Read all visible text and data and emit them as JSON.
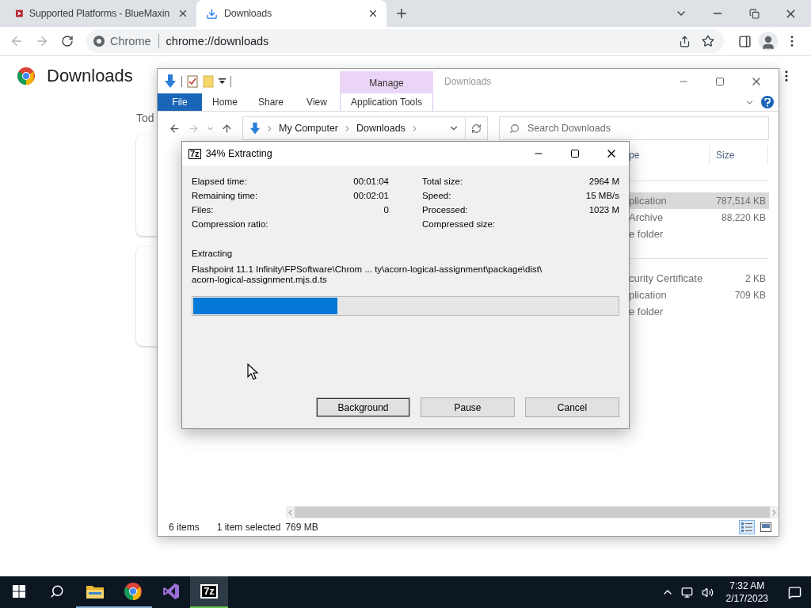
{
  "browser": {
    "tabs": [
      {
        "title": "Supported Platforms - BlueMaxin",
        "kind": "site",
        "selected": false
      },
      {
        "title": "Downloads",
        "kind": "download",
        "selected": true
      }
    ],
    "omnibox": {
      "site_label": "Chrome",
      "url": "chrome://downloads"
    },
    "page": {
      "title": "Downloads",
      "section_heading": "Tod"
    }
  },
  "explorer": {
    "context_group": "Manage",
    "title": "Downloads",
    "ribbon_tabs": [
      {
        "label": "File",
        "kind": "file"
      },
      {
        "label": "Home",
        "kind": "tab"
      },
      {
        "label": "Share",
        "kind": "tab"
      },
      {
        "label": "View",
        "kind": "tab"
      },
      {
        "label": "Application Tools",
        "kind": "context"
      }
    ],
    "breadcrumbs": [
      "My Computer",
      "Downloads"
    ],
    "search": {
      "placeholder": "Search Downloads"
    },
    "columns": [
      "pe",
      "Size"
    ],
    "groups": [
      {
        "rows": [
          {
            "type": "plication",
            "size": "787,514 KB",
            "selected": true
          },
          {
            "type": "Archive",
            "size": "88,220 KB",
            "selected": false
          },
          {
            "type": "e folder",
            "selected": false
          }
        ]
      },
      {
        "rows": [
          {
            "type": "curity Certificate",
            "size": "2 KB",
            "selected": false
          },
          {
            "type": "plication",
            "size": "709 KB",
            "selected": false
          },
          {
            "type": "e folder",
            "selected": false
          }
        ]
      }
    ],
    "status": {
      "item_count": "6 items",
      "selection": "1 item selected",
      "selection_size": "769 MB"
    }
  },
  "dialog": {
    "icon_label": "7z",
    "title": "34% Extracting",
    "stats_left": [
      {
        "label": "Elapsed time:",
        "value": "00:01:04"
      },
      {
        "label": "Remaining time:",
        "value": "00:02:01"
      },
      {
        "label": "Files:",
        "value": "0"
      },
      {
        "label": "Compression ratio:"
      }
    ],
    "stats_right": [
      {
        "label": "Total size:",
        "value": "2964 M"
      },
      {
        "label": "Speed:",
        "value": "15 MB/s"
      },
      {
        "label": "Processed:",
        "value": "1023 M"
      },
      {
        "label": "Compressed size:"
      }
    ],
    "operation": "Extracting",
    "path_lines": [
      "Flashpoint 11.1 Infinity\\FPSoftware\\Chrom ... ty\\acorn-logical-assignment\\package\\dist\\",
      "acorn-logical-assignment.mjs.d.ts"
    ],
    "level": 0.34,
    "buttons": [
      "Background",
      "Pause",
      "Cancel"
    ]
  },
  "taskbar": {
    "apps": [
      {
        "kind": "explorer",
        "running": true,
        "active": false
      },
      {
        "kind": "chrome",
        "running": true,
        "active": false
      },
      {
        "kind": "studio",
        "running": false,
        "active": false
      },
      {
        "kind": "sevenzip",
        "label": "7z",
        "running": true,
        "active": true
      }
    ],
    "time": "7:32 AM",
    "date": "2/17/2023"
  }
}
